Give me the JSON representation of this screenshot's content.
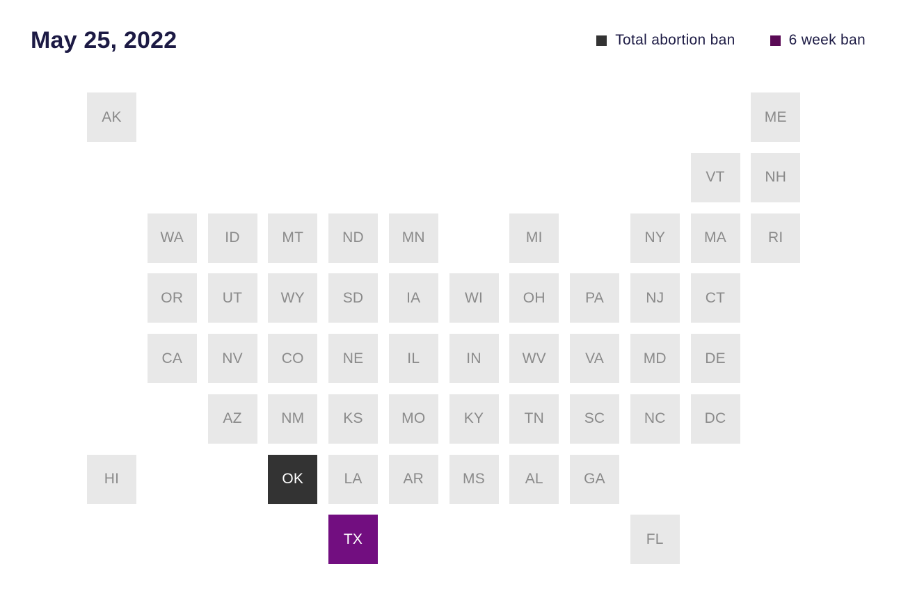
{
  "header": {
    "title": "May 25, 2022"
  },
  "legend": {
    "items": [
      {
        "key": "total",
        "label": "Total abortion ban",
        "color": "#333333"
      },
      {
        "key": "six",
        "label": "6 week ban",
        "color": "#5a0a55"
      }
    ]
  },
  "colors": {
    "none": "#e8e8e8",
    "none_text": "#8a8a8a",
    "total": "#333333",
    "six": "#720e80",
    "banned_text": "#ffffff",
    "title_text": "#1c1a44"
  },
  "chart_data": {
    "type": "heatmap",
    "title": "May 25, 2022",
    "subtype": "us-state-tile-grid-map",
    "legend": [
      "Total abortion ban",
      "6 week ban"
    ],
    "legend_position": "top-right",
    "states": [
      {
        "abbr": "AK",
        "row": 0,
        "col": 0,
        "status": "none"
      },
      {
        "abbr": "ME",
        "row": 0,
        "col": 11,
        "status": "none"
      },
      {
        "abbr": "VT",
        "row": 1,
        "col": 10,
        "status": "none"
      },
      {
        "abbr": "NH",
        "row": 1,
        "col": 11,
        "status": "none"
      },
      {
        "abbr": "WA",
        "row": 2,
        "col": 1,
        "status": "none"
      },
      {
        "abbr": "ID",
        "row": 2,
        "col": 2,
        "status": "none"
      },
      {
        "abbr": "MT",
        "row": 2,
        "col": 3,
        "status": "none"
      },
      {
        "abbr": "ND",
        "row": 2,
        "col": 4,
        "status": "none"
      },
      {
        "abbr": "MN",
        "row": 2,
        "col": 5,
        "status": "none"
      },
      {
        "abbr": "MI",
        "row": 2,
        "col": 7,
        "status": "none"
      },
      {
        "abbr": "NY",
        "row": 2,
        "col": 9,
        "status": "none"
      },
      {
        "abbr": "MA",
        "row": 2,
        "col": 10,
        "status": "none"
      },
      {
        "abbr": "RI",
        "row": 2,
        "col": 11,
        "status": "none"
      },
      {
        "abbr": "OR",
        "row": 3,
        "col": 1,
        "status": "none"
      },
      {
        "abbr": "UT",
        "row": 3,
        "col": 2,
        "status": "none"
      },
      {
        "abbr": "WY",
        "row": 3,
        "col": 3,
        "status": "none"
      },
      {
        "abbr": "SD",
        "row": 3,
        "col": 4,
        "status": "none"
      },
      {
        "abbr": "IA",
        "row": 3,
        "col": 5,
        "status": "none"
      },
      {
        "abbr": "WI",
        "row": 3,
        "col": 6,
        "status": "none"
      },
      {
        "abbr": "OH",
        "row": 3,
        "col": 7,
        "status": "none"
      },
      {
        "abbr": "PA",
        "row": 3,
        "col": 8,
        "status": "none"
      },
      {
        "abbr": "NJ",
        "row": 3,
        "col": 9,
        "status": "none"
      },
      {
        "abbr": "CT",
        "row": 3,
        "col": 10,
        "status": "none"
      },
      {
        "abbr": "CA",
        "row": 4,
        "col": 1,
        "status": "none"
      },
      {
        "abbr": "NV",
        "row": 4,
        "col": 2,
        "status": "none"
      },
      {
        "abbr": "CO",
        "row": 4,
        "col": 3,
        "status": "none"
      },
      {
        "abbr": "NE",
        "row": 4,
        "col": 4,
        "status": "none"
      },
      {
        "abbr": "IL",
        "row": 4,
        "col": 5,
        "status": "none"
      },
      {
        "abbr": "IN",
        "row": 4,
        "col": 6,
        "status": "none"
      },
      {
        "abbr": "WV",
        "row": 4,
        "col": 7,
        "status": "none"
      },
      {
        "abbr": "VA",
        "row": 4,
        "col": 8,
        "status": "none"
      },
      {
        "abbr": "MD",
        "row": 4,
        "col": 9,
        "status": "none"
      },
      {
        "abbr": "DE",
        "row": 4,
        "col": 10,
        "status": "none"
      },
      {
        "abbr": "AZ",
        "row": 5,
        "col": 2,
        "status": "none"
      },
      {
        "abbr": "NM",
        "row": 5,
        "col": 3,
        "status": "none"
      },
      {
        "abbr": "KS",
        "row": 5,
        "col": 4,
        "status": "none"
      },
      {
        "abbr": "MO",
        "row": 5,
        "col": 5,
        "status": "none"
      },
      {
        "abbr": "KY",
        "row": 5,
        "col": 6,
        "status": "none"
      },
      {
        "abbr": "TN",
        "row": 5,
        "col": 7,
        "status": "none"
      },
      {
        "abbr": "SC",
        "row": 5,
        "col": 8,
        "status": "none"
      },
      {
        "abbr": "NC",
        "row": 5,
        "col": 9,
        "status": "none"
      },
      {
        "abbr": "DC",
        "row": 5,
        "col": 10,
        "status": "none"
      },
      {
        "abbr": "HI",
        "row": 6,
        "col": 0,
        "status": "none"
      },
      {
        "abbr": "OK",
        "row": 6,
        "col": 3,
        "status": "total"
      },
      {
        "abbr": "LA",
        "row": 6,
        "col": 4,
        "status": "none"
      },
      {
        "abbr": "AR",
        "row": 6,
        "col": 5,
        "status": "none"
      },
      {
        "abbr": "MS",
        "row": 6,
        "col": 6,
        "status": "none"
      },
      {
        "abbr": "AL",
        "row": 6,
        "col": 7,
        "status": "none"
      },
      {
        "abbr": "GA",
        "row": 6,
        "col": 8,
        "status": "none"
      },
      {
        "abbr": "TX",
        "row": 7,
        "col": 4,
        "status": "six"
      },
      {
        "abbr": "FL",
        "row": 7,
        "col": 9,
        "status": "none"
      }
    ]
  }
}
